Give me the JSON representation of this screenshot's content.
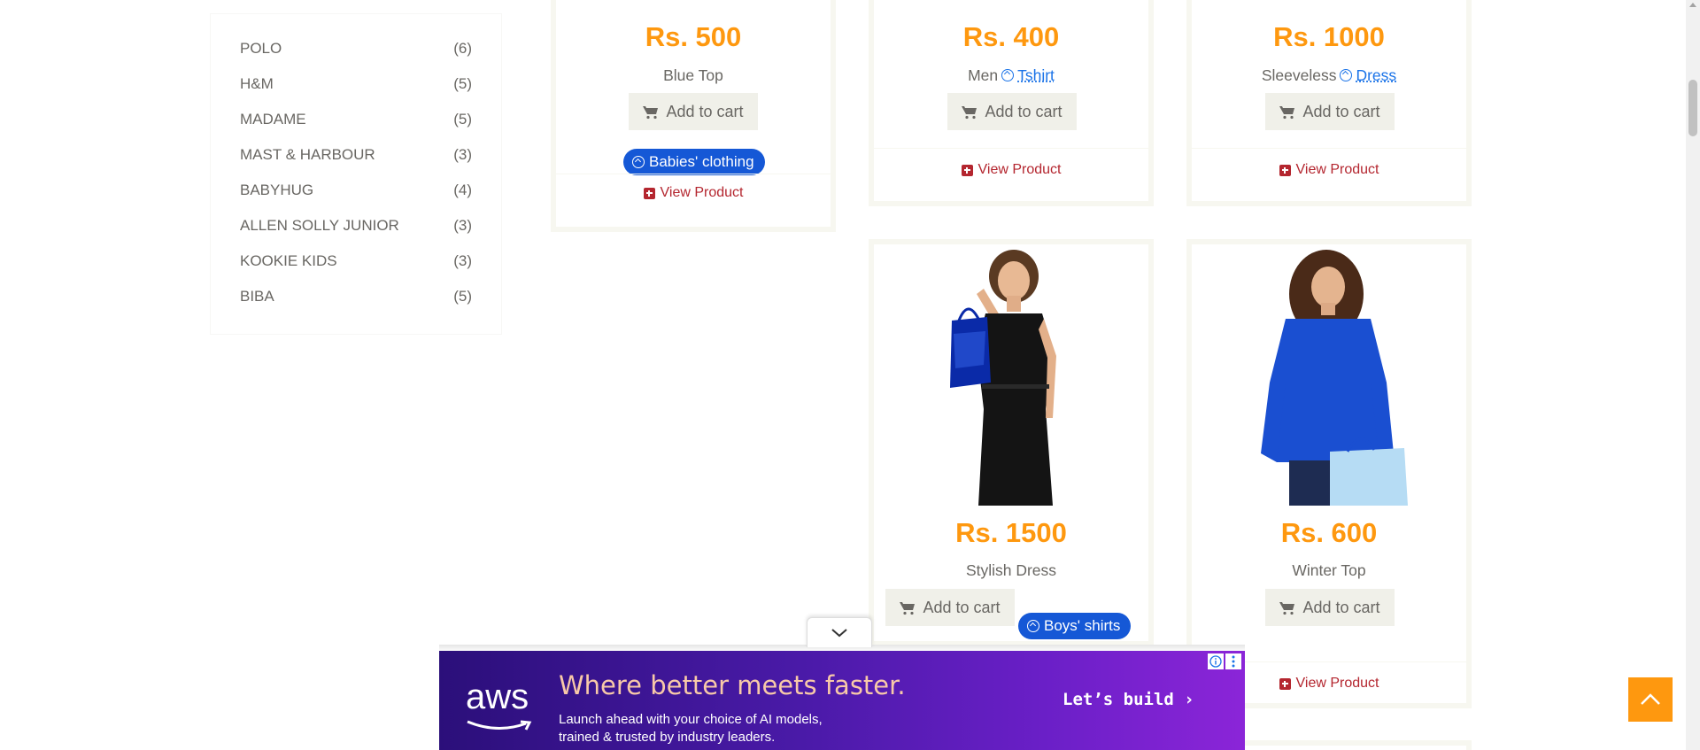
{
  "brands": [
    {
      "name": "POLO",
      "count": "(6)"
    },
    {
      "name": "H&M",
      "count": "(5)"
    },
    {
      "name": "MADAME",
      "count": "(5)"
    },
    {
      "name": "MAST & HARBOUR",
      "count": "(3)"
    },
    {
      "name": "BABYHUG",
      "count": "(4)"
    },
    {
      "name": "ALLEN SOLLY JUNIOR",
      "count": "(3)"
    },
    {
      "name": "KOOKIE KIDS",
      "count": "(3)"
    },
    {
      "name": "BIBA",
      "count": "(5)"
    }
  ],
  "products": {
    "p1": {
      "price": "Rs. 500",
      "name": "Blue Top",
      "add_label": "Add to cart",
      "view_label": "View Product",
      "pill": "Babies' clothing"
    },
    "p2": {
      "price": "Rs. 400",
      "name_prefix": "Men",
      "name_tag": "Tshirt",
      "add_label": "Add to cart",
      "view_label": "View Product"
    },
    "p3": {
      "price": "Rs. 1000",
      "name_prefix": "Sleeveless",
      "name_tag": "Dress",
      "add_label": "Add to cart",
      "view_label": "View Product"
    },
    "p4": {
      "price": "Rs. 1500",
      "name": "Stylish Dress",
      "add_label": "Add to cart",
      "pill": "Boys' shirts"
    },
    "p5": {
      "price": "Rs. 600",
      "name": "Winter Top",
      "add_label": "Add to cart",
      "view_label": "View Product"
    }
  },
  "ad": {
    "logo": "aws",
    "headline": "Where better meets faster.",
    "sub_line1": "Launch ahead with your choice of AI models,",
    "sub_line2": "trained & trusted by industry leaders.",
    "cta": "Let’s build ›"
  },
  "colors": {
    "price": "#fe980f",
    "view_link": "#b4262f",
    "pill": "#1558d6",
    "scroll_up": "#fe980f"
  }
}
